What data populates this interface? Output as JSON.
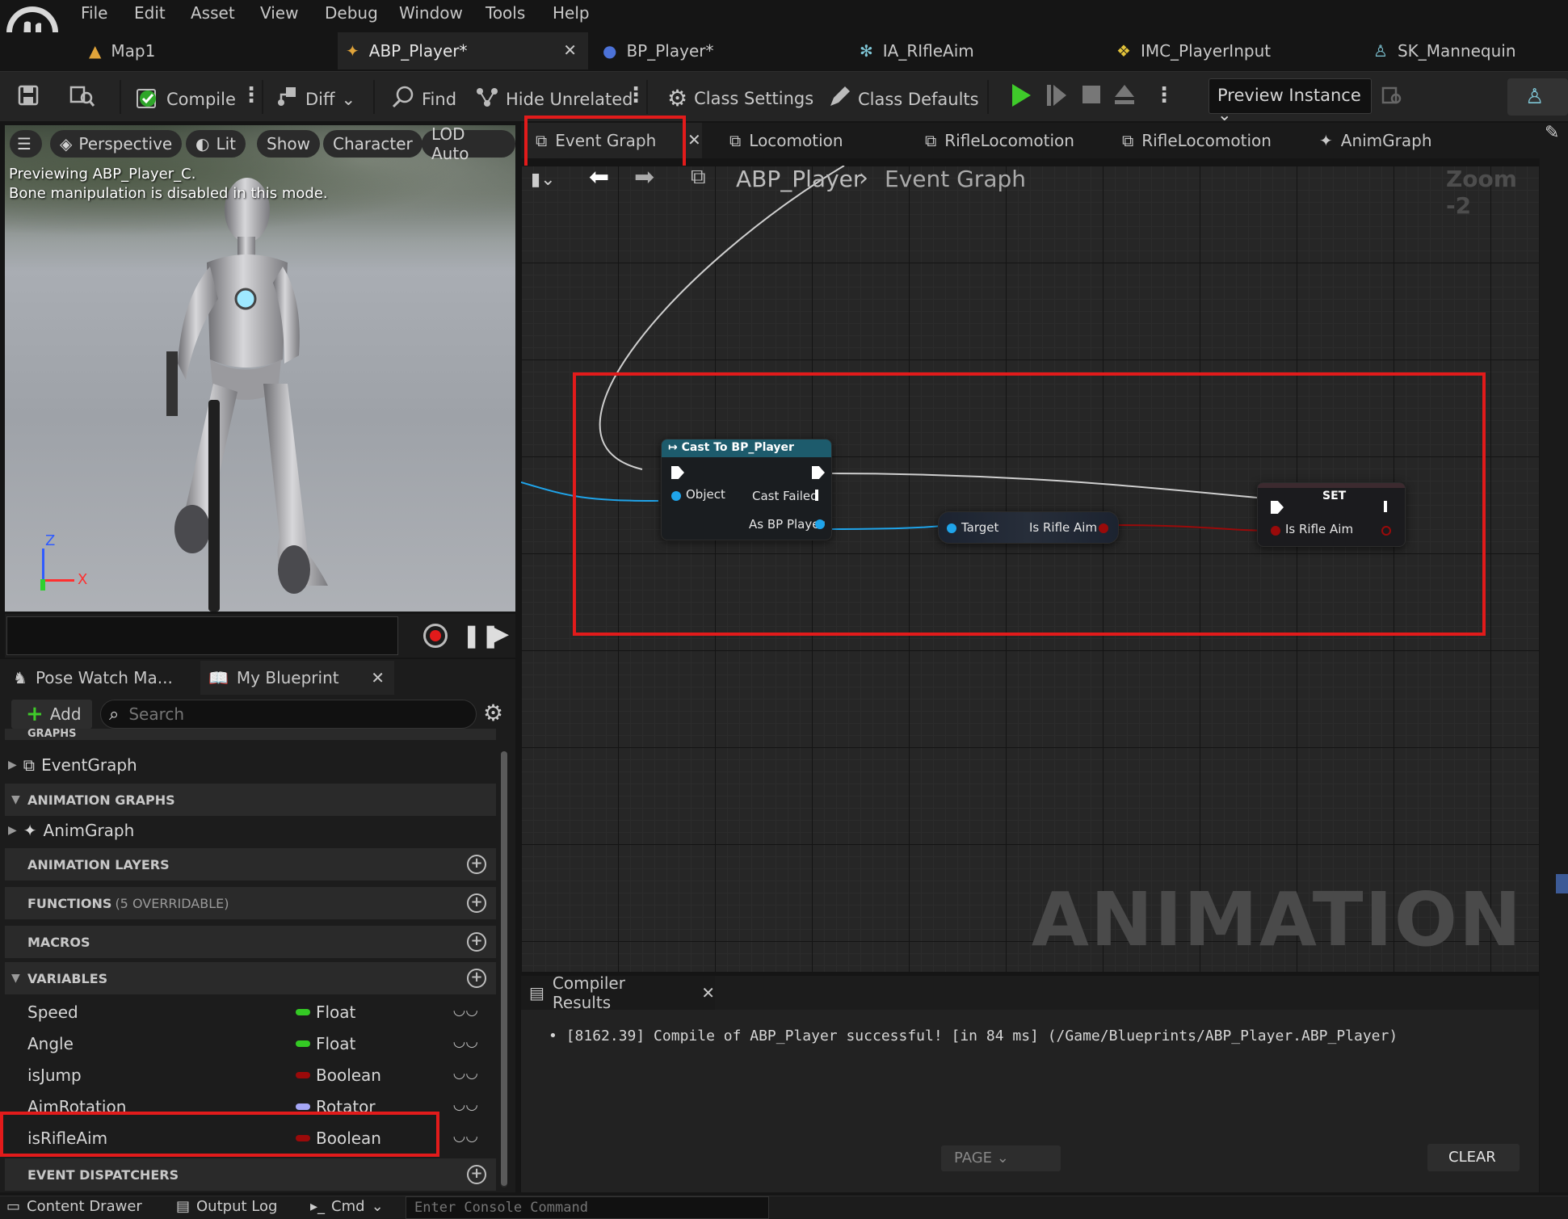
{
  "menu": {
    "items": [
      "File",
      "Edit",
      "Asset",
      "View",
      "Debug",
      "Window",
      "Tools",
      "Help"
    ]
  },
  "doc_tabs": [
    {
      "label": "Map1",
      "icon": "level-icon"
    },
    {
      "label": "ABP_Player*",
      "icon": "anim-blueprint-icon",
      "active": true
    },
    {
      "label": "BP_Player*",
      "icon": "blueprint-icon"
    },
    {
      "label": "IA_RIfleAim",
      "icon": "input-action-icon"
    },
    {
      "label": "IMC_PlayerInput",
      "icon": "mapping-context-icon"
    },
    {
      "label": "SK_Mannequin",
      "icon": "skeleton-icon"
    }
  ],
  "toolbar": {
    "compile": "Compile",
    "diff": "Diff",
    "find": "Find",
    "hide_unrelated": "Hide Unrelated",
    "class_settings": "Class Settings",
    "class_defaults": "Class Defaults",
    "preview_instance": "Preview Instance"
  },
  "viewport": {
    "perspective": "Perspective",
    "lit": "Lit",
    "show": "Show",
    "character": "Character",
    "lod": "LOD Auto",
    "overlay_line1": "Previewing ABP_Player_C.",
    "overlay_line2": "Bone manipulation is disabled in this mode.",
    "axis_z": "Z",
    "axis_x": "X"
  },
  "left_panel": {
    "tab_pose_watch": "Pose Watch Ma...",
    "tab_my_blueprint": "My Blueprint",
    "add_label": "Add",
    "search_placeholder": "Search",
    "graphs_header": "GRAPHS",
    "event_graph_item": "EventGraph",
    "animation_graphs_header": "ANIMATION GRAPHS",
    "anim_graph_item": "AnimGraph",
    "animation_layers_header": "ANIMATION LAYERS",
    "functions_header": "FUNCTIONS",
    "functions_sub": "(5 OVERRIDABLE)",
    "macros_header": "MACROS",
    "variables_header": "VARIABLES",
    "event_dispatchers_header": "EVENT DISPATCHERS",
    "variables": [
      {
        "name": "Speed",
        "type": "Float",
        "color": "#34c924"
      },
      {
        "name": "Angle",
        "type": "Float",
        "color": "#34c924"
      },
      {
        "name": "isJump",
        "type": "Boolean",
        "color": "#9a0a0a"
      },
      {
        "name": "AimRotation",
        "type": "Rotator",
        "color": "#a5a6f5"
      },
      {
        "name": "isRifleAim",
        "type": "Boolean",
        "color": "#9a0a0a"
      }
    ]
  },
  "graph_tabs": [
    {
      "label": "Event Graph",
      "active": true
    },
    {
      "label": "Locomotion"
    },
    {
      "label": "RifleLocomotion"
    },
    {
      "label": "RifleLocomotion"
    },
    {
      "label": "AnimGraph"
    }
  ],
  "breadcrumb": {
    "root": "ABP_Player",
    "current": "Event Graph",
    "zoom": "Zoom -2"
  },
  "graph": {
    "watermark": "ANIMATION",
    "cast_node": {
      "title": "Cast To BP_Player",
      "object_pin": "Object",
      "cast_failed_pin": "Cast Failed",
      "as_pin": "As BP Player"
    },
    "get_node": {
      "target_pin": "Target",
      "output_pin": "Is Rifle Aim"
    },
    "set_node": {
      "title": "SET",
      "input_pin": "Is Rifle Aim"
    }
  },
  "compiler": {
    "tab_label": "Compiler Results",
    "message": "[8162.39] Compile of ABP_Player successful! [in 84 ms] (/Game/Blueprints/ABP_Player.ABP_Player)",
    "page_label": "PAGE",
    "clear_label": "CLEAR"
  },
  "statusbar": {
    "content_drawer": "Content Drawer",
    "output_log": "Output Log",
    "cmd": "Cmd",
    "console_placeholder": "Enter Console Command"
  },
  "colors": {
    "highlight_red": "#e21b1b",
    "bool_pin": "#9a0a0a",
    "object_pin": "#1fa4ea",
    "float_pin": "#34c924",
    "play_green": "#3fcb2a"
  }
}
